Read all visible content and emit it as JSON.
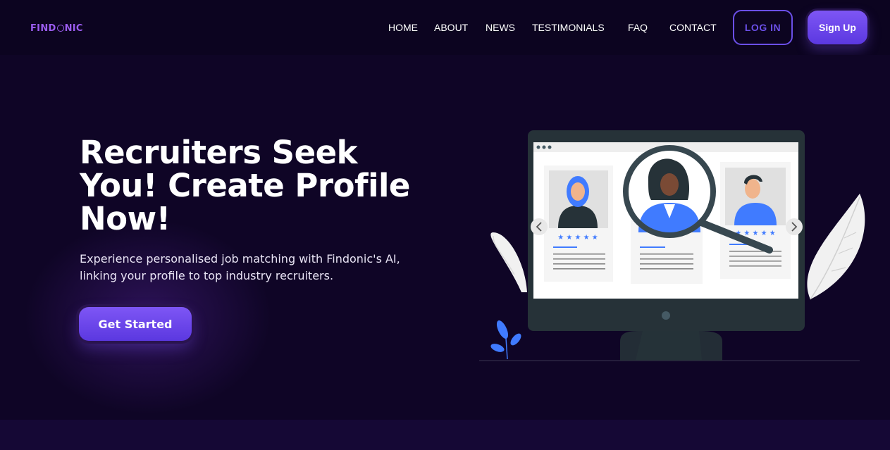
{
  "brand": {
    "name_pre": "FIND",
    "name_post": "NIC",
    "full_name": "FINDONIC",
    "accent": "#9b5cf0"
  },
  "nav": {
    "links": [
      {
        "label": "HOME"
      },
      {
        "label": "ABOUT"
      },
      {
        "label": "NEWS"
      },
      {
        "label": "TESTIMONIALS"
      },
      {
        "label": "FAQ"
      },
      {
        "label": "CONTACT"
      }
    ],
    "login_label": "LOG IN",
    "signup_label": "Sign Up"
  },
  "hero": {
    "title": "Recruiters Seek You! Create Profile Now!",
    "subtitle": "Experience personalised job matching with Findonic's AI, linking your profile to top industry recruiters.",
    "cta_label": "Get Started"
  },
  "illustration": {
    "icons": [
      "monitor-icon",
      "magnifier-icon",
      "chevron-left-icon",
      "chevron-right-icon",
      "leaf-icon",
      "star-icon"
    ],
    "colors": {
      "monitor": "#263238",
      "accent_blue": "#407bff",
      "screen": "#ffffff"
    }
  },
  "colors": {
    "background": "#0f0526",
    "navbar": "#0c0420",
    "button": "#6b4fe8",
    "footer": "#150835"
  }
}
